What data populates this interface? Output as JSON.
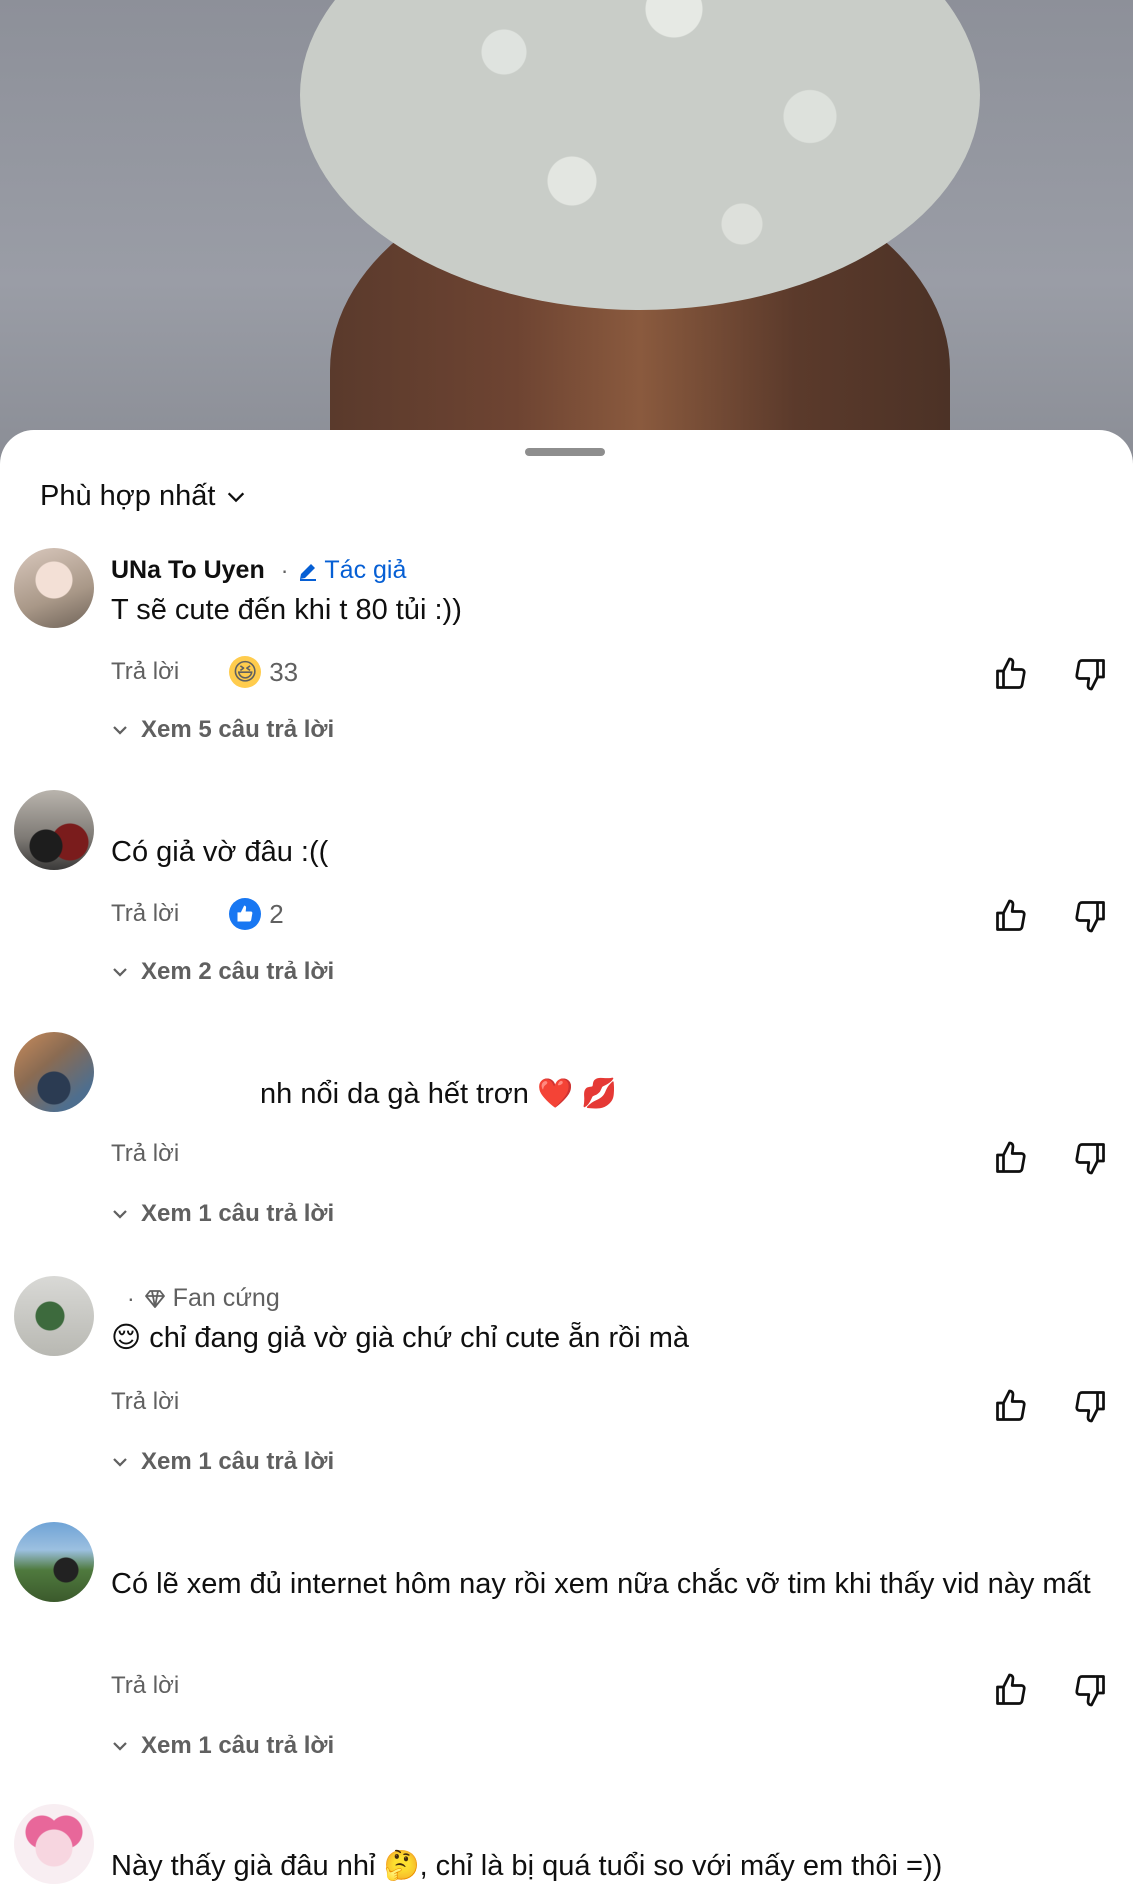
{
  "sort": {
    "label": "Phù hợp nhất"
  },
  "reply_label": "Trả lời",
  "comments": [
    {
      "name": "UNa To Uyen",
      "time": "",
      "badge": "Tác giả",
      "text": "T sẽ cute đến khi t 80 tủi :))",
      "reaction": "33",
      "replies": "Xem 5 câu trả lời"
    },
    {
      "name": "",
      "time": "",
      "text": "Có giả vờ đâu :((",
      "reaction": "2",
      "replies": "Xem 2 câu trả lời"
    },
    {
      "name": "",
      "time": "",
      "text": "nh nổi da gà hết trơn ❤️ 💋",
      "replies": "Xem 1 câu trả lời"
    },
    {
      "name": "",
      "time": "",
      "badge": "Fan cứng",
      "text": "😌 chỉ đang giả vờ già chứ chỉ cute ẵn rồi mà",
      "replies": "Xem 1 câu trả lời"
    },
    {
      "name": "",
      "time": "",
      "text": "Có lẽ xem đủ internet hôm nay rồi xem nữa chắc vỡ tim khi thấy vid này mất",
      "replies": "Xem 1 câu trả lời"
    },
    {
      "name": "",
      "time": "",
      "text": "Này thấy già đâu nhỉ 🤔, chỉ là bị quá tuổi so với mấy em thôi =))"
    }
  ]
}
